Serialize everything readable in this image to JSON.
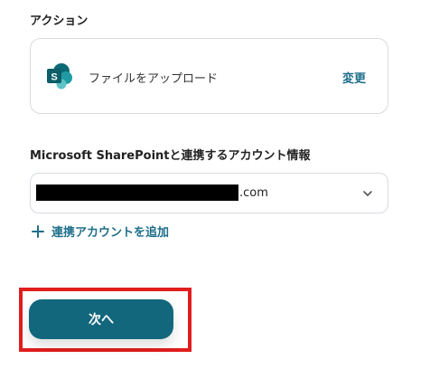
{
  "action_section": {
    "label": "アクション",
    "app_icon": "sharepoint-icon",
    "action_name": "ファイルをアップロード",
    "change_label": "変更"
  },
  "account_section": {
    "label": "Microsoft SharePointと連携するアカウント情報",
    "selected_value_suffix": ".com",
    "chevron_icon": "chevron-down-icon",
    "add_account_label": "連携アカウントを追加",
    "add_icon": "plus-icon"
  },
  "footer": {
    "next_label": "次へ"
  },
  "colors": {
    "accent": "#12677d",
    "link": "#1f6f8b",
    "highlight": "#e11d1d"
  }
}
